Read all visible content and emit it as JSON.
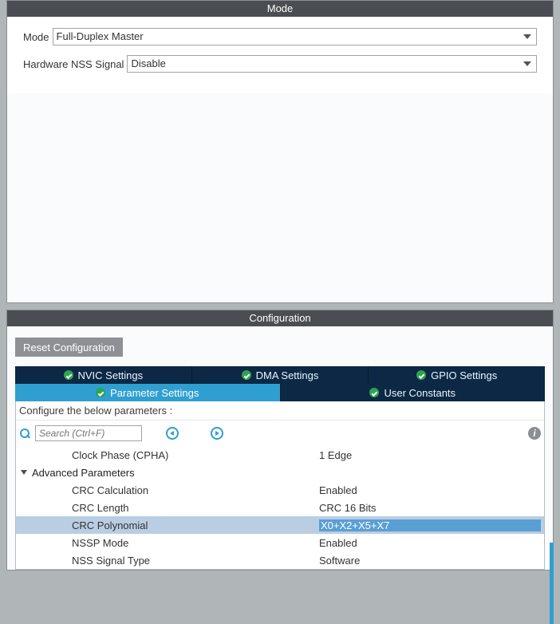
{
  "mode": {
    "header": "Mode",
    "mode_label": "Mode",
    "mode_value": "Full-Duplex Master",
    "nss_label": "Hardware NSS Signal",
    "nss_value": "Disable"
  },
  "configuration": {
    "header": "Configuration",
    "reset_button": "Reset Configuration",
    "tabs_row1": [
      {
        "label": "NVIC Settings"
      },
      {
        "label": "DMA Settings"
      },
      {
        "label": "GPIO Settings"
      }
    ],
    "tabs_row2": [
      {
        "label": "Parameter Settings",
        "active": true
      },
      {
        "label": "User Constants"
      }
    ],
    "instruction": "Configure the below parameters :",
    "search_placeholder": "Search (Ctrl+F)",
    "params": {
      "clock_phase_label": "Clock Phase (CPHA)",
      "clock_phase_value": "1 Edge",
      "group_label": "Advanced Parameters",
      "rows": [
        {
          "name": "CRC Calculation",
          "value": "Enabled"
        },
        {
          "name": "CRC Length",
          "value": "CRC 16 Bits"
        },
        {
          "name": "CRC Polynomial",
          "value": "X0+X2+X5+X7",
          "selected": true
        },
        {
          "name": "NSSP Mode",
          "value": "Enabled"
        },
        {
          "name": "NSS Signal Type",
          "value": "Software"
        }
      ]
    }
  }
}
